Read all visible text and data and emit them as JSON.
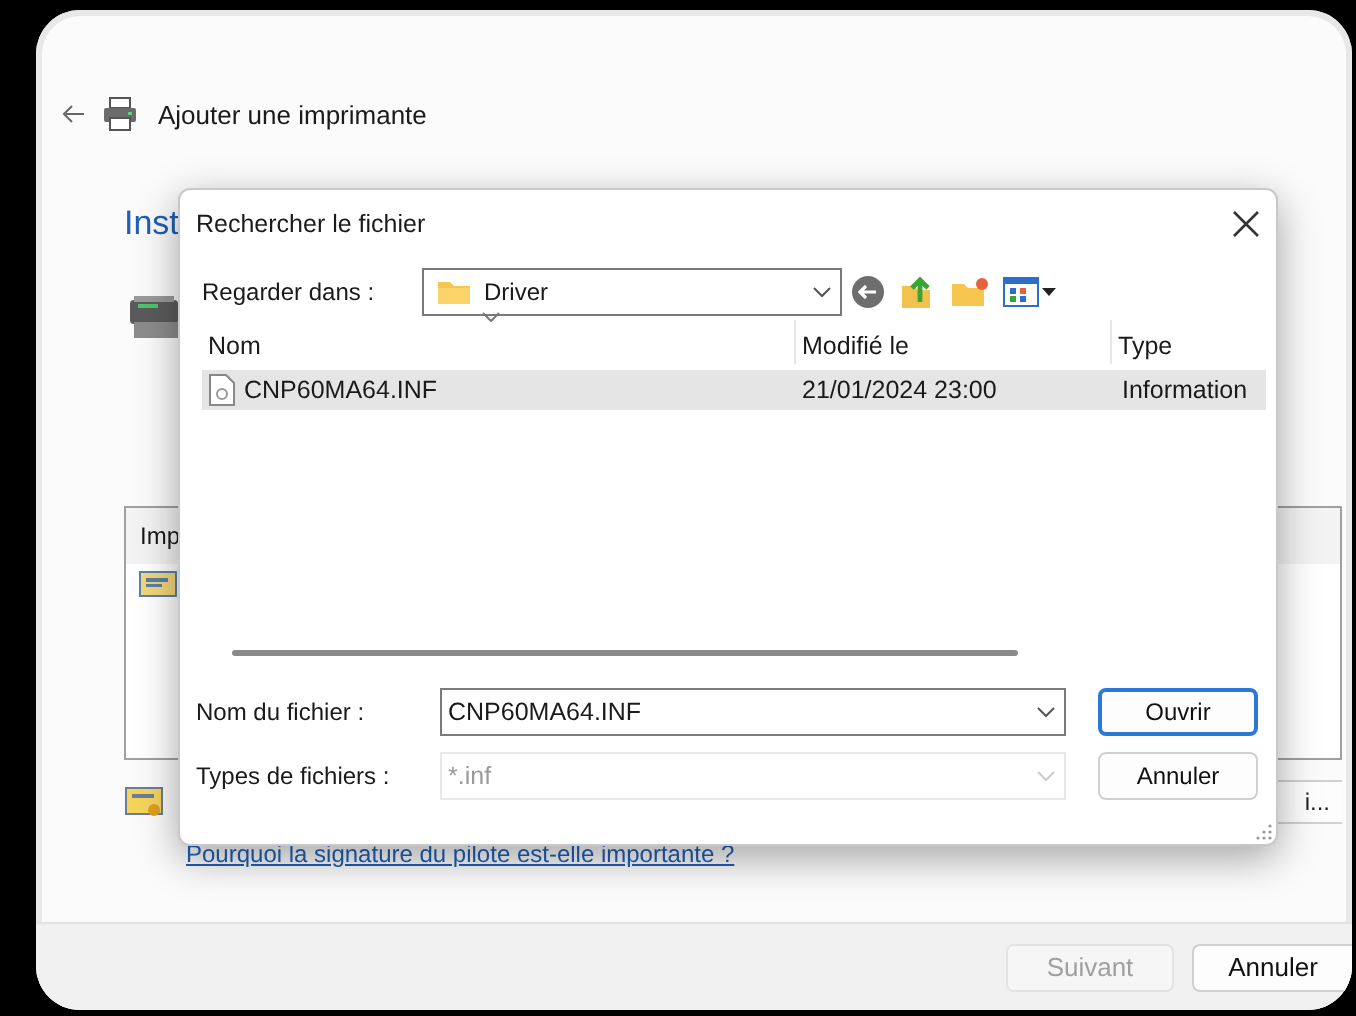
{
  "window": {
    "title": "Ajouter une imprimante",
    "heading": "Inst",
    "list_header": "Imp",
    "side_button": "i...",
    "link": "Pourquoi la signature du pilote est-elle importante ?",
    "buttons": [
      {
        "label": "Suivant",
        "disabled": true
      },
      {
        "label": "Annuler",
        "disabled": false
      }
    ]
  },
  "dialog": {
    "title": "Rechercher le fichier",
    "look_in_label": "Regarder dans :",
    "look_in_value": "Driver",
    "columns": [
      {
        "label": "Nom",
        "sorted": true
      },
      {
        "label": "Modifié le",
        "sorted": false
      },
      {
        "label": "Type",
        "sorted": false
      }
    ],
    "files": [
      {
        "name": "CNP60MA64.INF",
        "modified": "21/01/2024 23:00",
        "type": "Information",
        "selected": true
      }
    ],
    "file_name_label": "Nom du fichier :",
    "file_name_value": "CNP60MA64.INF",
    "file_type_label": "Types de fichiers :",
    "file_type_value": "*.inf",
    "file_type_disabled": true,
    "buttons": [
      {
        "label": "Ouvrir",
        "default": true
      },
      {
        "label": "Annuler",
        "default": false
      }
    ]
  }
}
